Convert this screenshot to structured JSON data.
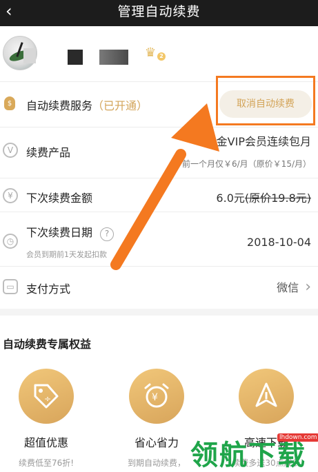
{
  "header": {
    "back_icon": "‹",
    "title": "管理自动续费"
  },
  "user": {
    "vip_level": "2"
  },
  "service": {
    "label": "自动续费服务",
    "status": "（已开通）",
    "cancel_label": "取消自动续费"
  },
  "product": {
    "label": "续费产品",
    "value": "黄金VIP会员连续包月",
    "sub": "前一个月仅￥6/月（原价￥15/月）"
  },
  "amount": {
    "label": "下次续费金额",
    "value": "6.0元",
    "original": "(原价19.8元)"
  },
  "date": {
    "label": "下次续费日期",
    "help_icon": "?",
    "value": "2018-10-04",
    "sub": "会员到期前1天发起扣款"
  },
  "payment": {
    "label": "支付方式",
    "value": "微信",
    "chevron": "›"
  },
  "benefits": {
    "title": "自动续费专属权益",
    "items": [
      {
        "title": "超值优惠",
        "desc": "续费低至76折!"
      },
      {
        "title": "省心省力",
        "desc": "到期自动续费，"
      },
      {
        "title": "高速下载",
        "desc": "续费多送30点成长"
      }
    ]
  },
  "watermark": {
    "text": "领航下载",
    "site": "lhdown.com"
  },
  "colors": {
    "accent": "#d3a458",
    "annotation": "#f47920",
    "topbar": "#1c1c1c"
  }
}
